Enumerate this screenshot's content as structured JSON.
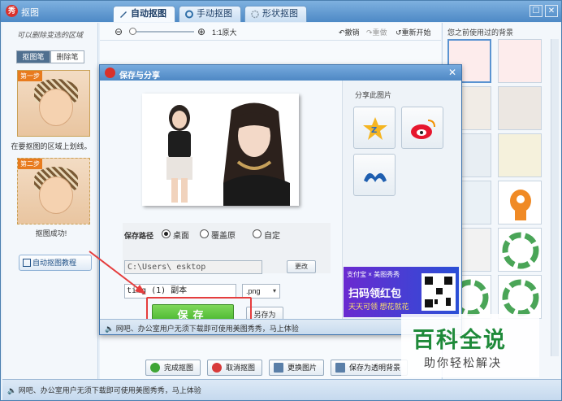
{
  "app": {
    "title": "抠图",
    "logo_text": "秀"
  },
  "tabs": [
    {
      "label": "自动抠图",
      "active": true
    },
    {
      "label": "手动抠图",
      "active": false
    },
    {
      "label": "形状抠图",
      "active": false
    }
  ],
  "window_buttons": {
    "maximize": "☐",
    "close": "✕"
  },
  "left_panel": {
    "hint": "可以删除变选的区域",
    "pen_tabs": [
      "抠图笔",
      "删除笔"
    ],
    "step1_tag": "第一步",
    "step1_caption": "在要抠图的区域上划线。",
    "step2_tag": "第二步",
    "step2_caption": "抠图成功!",
    "tutorial_label": "自动抠图教程"
  },
  "toolbar": {
    "zoom_minus": "⊖",
    "zoom_plus": "⊕",
    "original_size": "1:1原大",
    "undo": "撤销",
    "redo": "重做",
    "restart": "重新开始"
  },
  "right_panel": {
    "title": "您之前使用过的背景"
  },
  "bottom": {
    "tip": "网吧、办公室用户无须下载即可使用美图秀秀，马上体验",
    "buttons": [
      "完成抠图",
      "取消抠图",
      "更换图片",
      "保存为透明背景"
    ]
  },
  "dialog": {
    "title": "保存与分享",
    "close": "✕",
    "share_title": "分享此图片",
    "save_path_label": "保存路径",
    "path_options": [
      {
        "label": "桌面",
        "selected": true
      },
      {
        "label": "覆盖原",
        "selected": false
      },
      {
        "label": "自定",
        "selected": false
      }
    ],
    "path_value": "C:\\Users\\        esktop",
    "change_button": "更改",
    "filename": "timg (1) 副本",
    "format": ".png",
    "format_arrow": "▾",
    "save_button": "保存",
    "save_as_button": "另存为",
    "footer_tip": "网吧、办公室用户无须下载即可使用美图秀秀，马上体验",
    "ad": {
      "top": "支付宝 × 美图秀秀",
      "headline": "扫码领红包",
      "sub": "天天可领 想花就花"
    }
  },
  "watermark": {
    "main": "百科全说",
    "sub": "助你轻松解决"
  },
  "colors": {
    "accent": "#4d89c6",
    "save_green": "#3daf27",
    "highlight_red": "#e53d3d"
  }
}
